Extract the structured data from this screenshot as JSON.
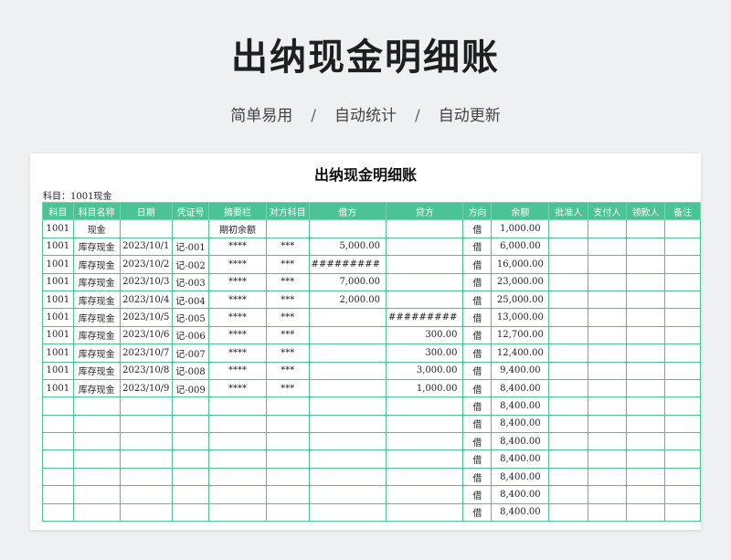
{
  "hero": {
    "title": "出纳现金明细账",
    "tags": [
      "简单易用",
      "自动统计",
      "自动更新"
    ],
    "separator": "/"
  },
  "sheet": {
    "title": "出纳现金明细账",
    "subject": "科目：1001现金",
    "columns": [
      "科目",
      "科目名称",
      "日期",
      "凭证号",
      "摘要栏",
      "对方科目",
      "借方",
      "贷方",
      "方向",
      "余额",
      "批准人",
      "支付人",
      "领款人",
      "备注"
    ],
    "rows": [
      [
        "1001",
        "现金",
        "",
        "",
        "期初余额",
        "",
        "",
        "",
        "借",
        "1,000.00",
        "",
        "",
        "",
        ""
      ],
      [
        "1001",
        "库存现金",
        "2023/10/1",
        "记-001",
        "****",
        "***",
        "5,000.00",
        "",
        "借",
        "6,000.00",
        "",
        "",
        "",
        ""
      ],
      [
        "1001",
        "库存现金",
        "2023/10/2",
        "记-002",
        "****",
        "***",
        "#########",
        "",
        "借",
        "16,000.00",
        "",
        "",
        "",
        ""
      ],
      [
        "1001",
        "库存现金",
        "2023/10/3",
        "记-003",
        "****",
        "***",
        "7,000.00",
        "",
        "借",
        "23,000.00",
        "",
        "",
        "",
        ""
      ],
      [
        "1001",
        "库存现金",
        "2023/10/4",
        "记-004",
        "****",
        "***",
        "2,000.00",
        "",
        "借",
        "25,000.00",
        "",
        "",
        "",
        ""
      ],
      [
        "1001",
        "库存现金",
        "2023/10/5",
        "记-005",
        "****",
        "***",
        "",
        "#########",
        "借",
        "13,000.00",
        "",
        "",
        "",
        ""
      ],
      [
        "1001",
        "库存现金",
        "2023/10/6",
        "记-006",
        "****",
        "***",
        "",
        "300.00",
        "借",
        "12,700.00",
        "",
        "",
        "",
        ""
      ],
      [
        "1001",
        "库存现金",
        "2023/10/7",
        "记-007",
        "****",
        "***",
        "",
        "300.00",
        "借",
        "12,400.00",
        "",
        "",
        "",
        ""
      ],
      [
        "1001",
        "库存现金",
        "2023/10/8",
        "记-008",
        "****",
        "***",
        "",
        "3,000.00",
        "借",
        "9,400.00",
        "",
        "",
        "",
        ""
      ],
      [
        "1001",
        "库存现金",
        "2023/10/9",
        "记-009",
        "****",
        "***",
        "",
        "1,000.00",
        "借",
        "8,400.00",
        "",
        "",
        "",
        ""
      ],
      [
        "",
        "",
        "",
        "",
        "",
        "",
        "",
        "",
        "借",
        "8,400.00",
        "",
        "",
        "",
        ""
      ],
      [
        "",
        "",
        "",
        "",
        "",
        "",
        "",
        "",
        "借",
        "8,400.00",
        "",
        "",
        "",
        ""
      ],
      [
        "",
        "",
        "",
        "",
        "",
        "",
        "",
        "",
        "借",
        "8,400.00",
        "",
        "",
        "",
        ""
      ],
      [
        "",
        "",
        "",
        "",
        "",
        "",
        "",
        "",
        "借",
        "8,400.00",
        "",
        "",
        "",
        ""
      ],
      [
        "",
        "",
        "",
        "",
        "",
        "",
        "",
        "",
        "借",
        "8,400.00",
        "",
        "",
        "",
        ""
      ],
      [
        "",
        "",
        "",
        "",
        "",
        "",
        "",
        "",
        "借",
        "8,400.00",
        "",
        "",
        "",
        ""
      ],
      [
        "",
        "",
        "",
        "",
        "",
        "",
        "",
        "",
        "借",
        "8,400.00",
        "",
        "",
        "",
        ""
      ]
    ]
  },
  "colors": {
    "header_bg": "#4cc396",
    "grid": "#4fbf94",
    "page_bg": "#eef0f2"
  }
}
